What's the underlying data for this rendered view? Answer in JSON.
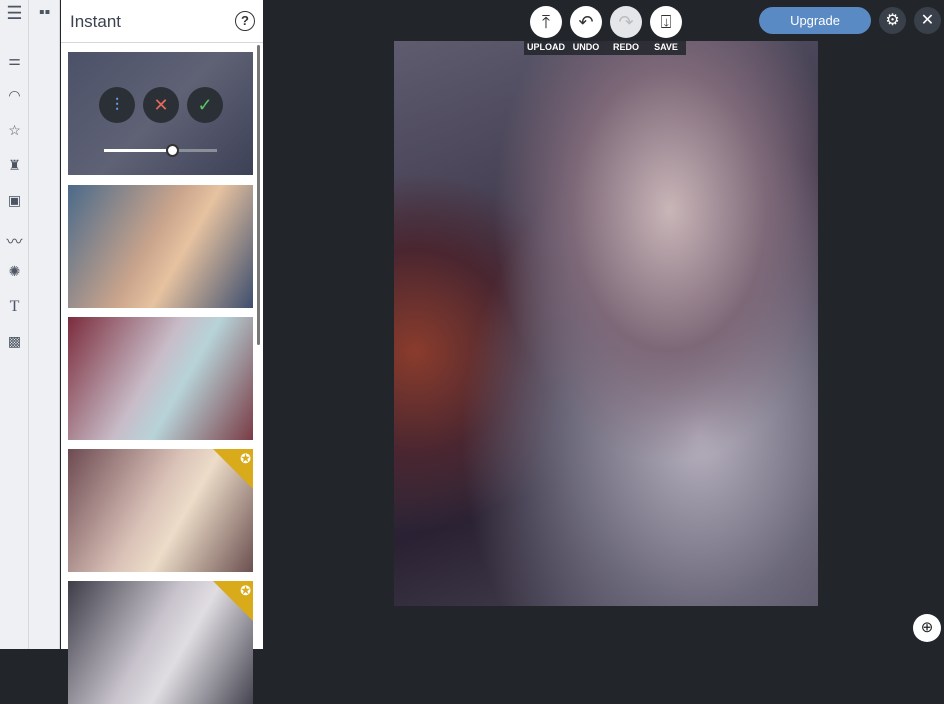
{
  "panel": {
    "title": "Instant",
    "help": "?"
  },
  "filter_controls": {
    "intensity_percent": 60
  },
  "toolbar": {
    "upload": "UPLOAD",
    "undo": "UNDO",
    "redo": "REDO",
    "save": "SAVE"
  },
  "header": {
    "upgrade": "Upgrade"
  },
  "thumbnails": [
    {
      "premium": false
    },
    {
      "premium": false
    },
    {
      "premium": false
    },
    {
      "premium": true
    },
    {
      "premium": true
    }
  ],
  "colors": {
    "accent": "#5a8ac4",
    "premium": "#d9aa19",
    "bg": "#22262b"
  }
}
